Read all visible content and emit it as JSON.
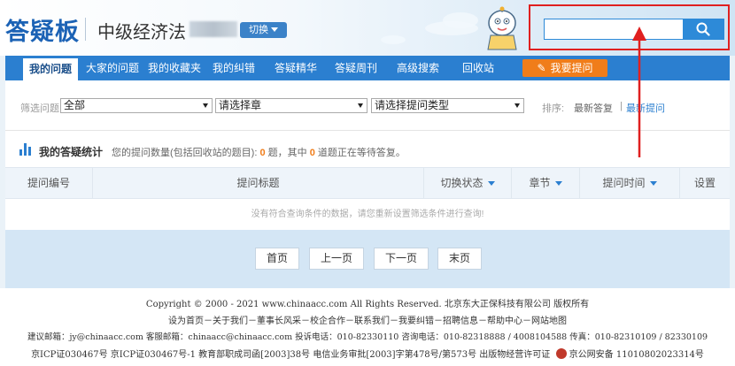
{
  "header": {
    "logo": "答疑板",
    "course": "中级经济法",
    "switch_label": "切换",
    "search": {
      "placeholder": ""
    }
  },
  "nav": {
    "items": [
      {
        "label": "我的问题"
      },
      {
        "label": "大家的问题"
      },
      {
        "label": "我的收藏夹"
      },
      {
        "label": "我的纠错"
      },
      {
        "label": "答疑精华"
      },
      {
        "label": "答疑周刊"
      },
      {
        "label": "高级搜索"
      },
      {
        "label": "回收站"
      }
    ],
    "ask_label": "我要提问"
  },
  "filter": {
    "label": "筛选问题",
    "select_all": "全部",
    "select_chapter": "请选择章",
    "select_type": "请选择提问类型",
    "sort_label": "排序:",
    "sort_latest_answer": "最新答复",
    "sort_sep": "|",
    "sort_latest_question": "最新提问"
  },
  "stats": {
    "title": "我的答疑统计",
    "text_prefix": "您的提问数量(包括回收站的题目):",
    "count_total": "0",
    "text_mid": "题，其中",
    "count_waiting": "0",
    "text_suffix": "道题正在等待答复。"
  },
  "table": {
    "headers": [
      "提问编号",
      "提问标题",
      "切换状态",
      "章节",
      "提问时间",
      "设置"
    ],
    "empty_message": "没有符合查询条件的数据，请您重新设置筛选条件进行查询!"
  },
  "pager": {
    "first": "首页",
    "prev": "上一页",
    "next": "下一页",
    "last": "末页"
  },
  "footer": {
    "line1": "Copyright © 2000 - 2021 www.chinaacc.com All Rights Reserved.  北京东大正保科技有限公司 版权所有",
    "line2": "设为首页－关于我们－董事长风采－校企合作－联系我们－我要纠错－招聘信息－帮助中心－网站地图",
    "line3": "建议邮箱：jy@chinaacc.com 客服邮箱：chinaacc@chinaacc.com 投诉电话：010-82330110 咨询电话：010-82318888 / 4008104588 传真：010-82310109 / 82330109",
    "line4": "京ICP证030467号   京ICP证030467号-1   教育部职成司函[2003]38号   电信业务审批[2003]字第478号/第573号   出版物经营许可证",
    "police": "京公网安备 11010802023314号"
  },
  "colors": {
    "brand_blue": "#2b7fd0",
    "ask_orange": "#f07d1a",
    "highlight_red": "#e02020"
  }
}
